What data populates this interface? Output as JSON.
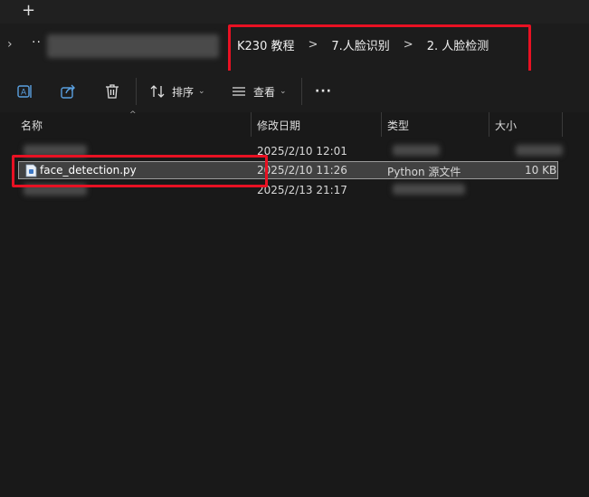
{
  "tabbar": {
    "new_tab_label": "+"
  },
  "addressbar": {
    "overflow_label": "··",
    "breadcrumbs": [
      "K230 教程",
      "7.人脸识别",
      "2. 人脸检测"
    ],
    "separator": ">"
  },
  "toolbar": {
    "sort_label": "排序",
    "view_label": "查看",
    "more_label": "···",
    "icons": [
      "rename-icon",
      "share-icon",
      "delete-icon",
      "sort-icon",
      "view-icon",
      "more-icon"
    ]
  },
  "columns": {
    "name": "名称",
    "modified": "修改日期",
    "type": "类型",
    "size": "大小"
  },
  "files": [
    {
      "name": "",
      "modified": "2025/2/10 12:01",
      "type": "",
      "size": "",
      "redacted": true
    },
    {
      "name": "face_detection.py",
      "modified": "2025/2/10 11:26",
      "type": "Python 源文件",
      "size": "10 KB",
      "selected": true
    },
    {
      "name": "",
      "modified": "2025/2/13 21:17",
      "type": "",
      "size": "",
      "redacted": true
    }
  ],
  "colors": {
    "highlight": "#e81123",
    "background": "#191919",
    "selection": "#414141"
  }
}
